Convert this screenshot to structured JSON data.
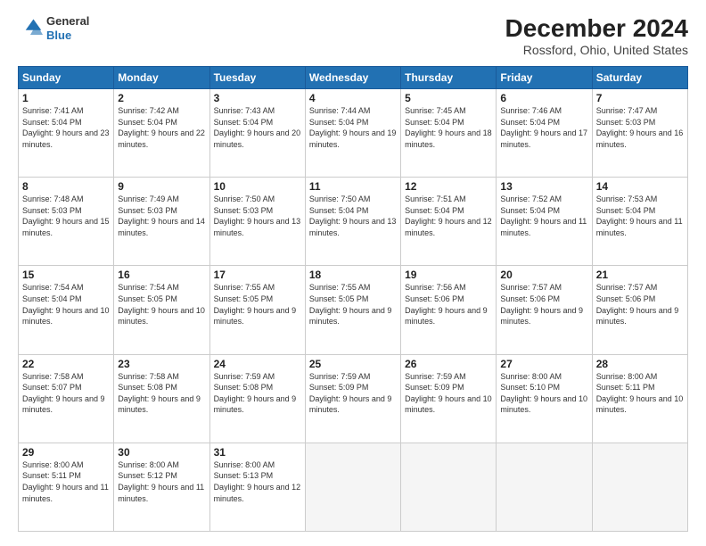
{
  "header": {
    "logo_line1": "General",
    "logo_line2": "Blue",
    "title": "December 2024",
    "subtitle": "Rossford, Ohio, United States"
  },
  "days_of_week": [
    "Sunday",
    "Monday",
    "Tuesday",
    "Wednesday",
    "Thursday",
    "Friday",
    "Saturday"
  ],
  "weeks": [
    [
      {
        "day": 1,
        "sunrise": "7:41 AM",
        "sunset": "5:04 PM",
        "daylight": "9 hours and 23 minutes."
      },
      {
        "day": 2,
        "sunrise": "7:42 AM",
        "sunset": "5:04 PM",
        "daylight": "9 hours and 22 minutes."
      },
      {
        "day": 3,
        "sunrise": "7:43 AM",
        "sunset": "5:04 PM",
        "daylight": "9 hours and 20 minutes."
      },
      {
        "day": 4,
        "sunrise": "7:44 AM",
        "sunset": "5:04 PM",
        "daylight": "9 hours and 19 minutes."
      },
      {
        "day": 5,
        "sunrise": "7:45 AM",
        "sunset": "5:04 PM",
        "daylight": "9 hours and 18 minutes."
      },
      {
        "day": 6,
        "sunrise": "7:46 AM",
        "sunset": "5:04 PM",
        "daylight": "9 hours and 17 minutes."
      },
      {
        "day": 7,
        "sunrise": "7:47 AM",
        "sunset": "5:03 PM",
        "daylight": "9 hours and 16 minutes."
      }
    ],
    [
      {
        "day": 8,
        "sunrise": "7:48 AM",
        "sunset": "5:03 PM",
        "daylight": "9 hours and 15 minutes."
      },
      {
        "day": 9,
        "sunrise": "7:49 AM",
        "sunset": "5:03 PM",
        "daylight": "9 hours and 14 minutes."
      },
      {
        "day": 10,
        "sunrise": "7:50 AM",
        "sunset": "5:03 PM",
        "daylight": "9 hours and 13 minutes."
      },
      {
        "day": 11,
        "sunrise": "7:50 AM",
        "sunset": "5:04 PM",
        "daylight": "9 hours and 13 minutes."
      },
      {
        "day": 12,
        "sunrise": "7:51 AM",
        "sunset": "5:04 PM",
        "daylight": "9 hours and 12 minutes."
      },
      {
        "day": 13,
        "sunrise": "7:52 AM",
        "sunset": "5:04 PM",
        "daylight": "9 hours and 11 minutes."
      },
      {
        "day": 14,
        "sunrise": "7:53 AM",
        "sunset": "5:04 PM",
        "daylight": "9 hours and 11 minutes."
      }
    ],
    [
      {
        "day": 15,
        "sunrise": "7:54 AM",
        "sunset": "5:04 PM",
        "daylight": "9 hours and 10 minutes."
      },
      {
        "day": 16,
        "sunrise": "7:54 AM",
        "sunset": "5:05 PM",
        "daylight": "9 hours and 10 minutes."
      },
      {
        "day": 17,
        "sunrise": "7:55 AM",
        "sunset": "5:05 PM",
        "daylight": "9 hours and 9 minutes."
      },
      {
        "day": 18,
        "sunrise": "7:55 AM",
        "sunset": "5:05 PM",
        "daylight": "9 hours and 9 minutes."
      },
      {
        "day": 19,
        "sunrise": "7:56 AM",
        "sunset": "5:06 PM",
        "daylight": "9 hours and 9 minutes."
      },
      {
        "day": 20,
        "sunrise": "7:57 AM",
        "sunset": "5:06 PM",
        "daylight": "9 hours and 9 minutes."
      },
      {
        "day": 21,
        "sunrise": "7:57 AM",
        "sunset": "5:06 PM",
        "daylight": "9 hours and 9 minutes."
      }
    ],
    [
      {
        "day": 22,
        "sunrise": "7:58 AM",
        "sunset": "5:07 PM",
        "daylight": "9 hours and 9 minutes."
      },
      {
        "day": 23,
        "sunrise": "7:58 AM",
        "sunset": "5:08 PM",
        "daylight": "9 hours and 9 minutes."
      },
      {
        "day": 24,
        "sunrise": "7:59 AM",
        "sunset": "5:08 PM",
        "daylight": "9 hours and 9 minutes."
      },
      {
        "day": 25,
        "sunrise": "7:59 AM",
        "sunset": "5:09 PM",
        "daylight": "9 hours and 9 minutes."
      },
      {
        "day": 26,
        "sunrise": "7:59 AM",
        "sunset": "5:09 PM",
        "daylight": "9 hours and 10 minutes."
      },
      {
        "day": 27,
        "sunrise": "8:00 AM",
        "sunset": "5:10 PM",
        "daylight": "9 hours and 10 minutes."
      },
      {
        "day": 28,
        "sunrise": "8:00 AM",
        "sunset": "5:11 PM",
        "daylight": "9 hours and 10 minutes."
      }
    ],
    [
      {
        "day": 29,
        "sunrise": "8:00 AM",
        "sunset": "5:11 PM",
        "daylight": "9 hours and 11 minutes."
      },
      {
        "day": 30,
        "sunrise": "8:00 AM",
        "sunset": "5:12 PM",
        "daylight": "9 hours and 11 minutes."
      },
      {
        "day": 31,
        "sunrise": "8:00 AM",
        "sunset": "5:13 PM",
        "daylight": "9 hours and 12 minutes."
      },
      null,
      null,
      null,
      null
    ]
  ]
}
